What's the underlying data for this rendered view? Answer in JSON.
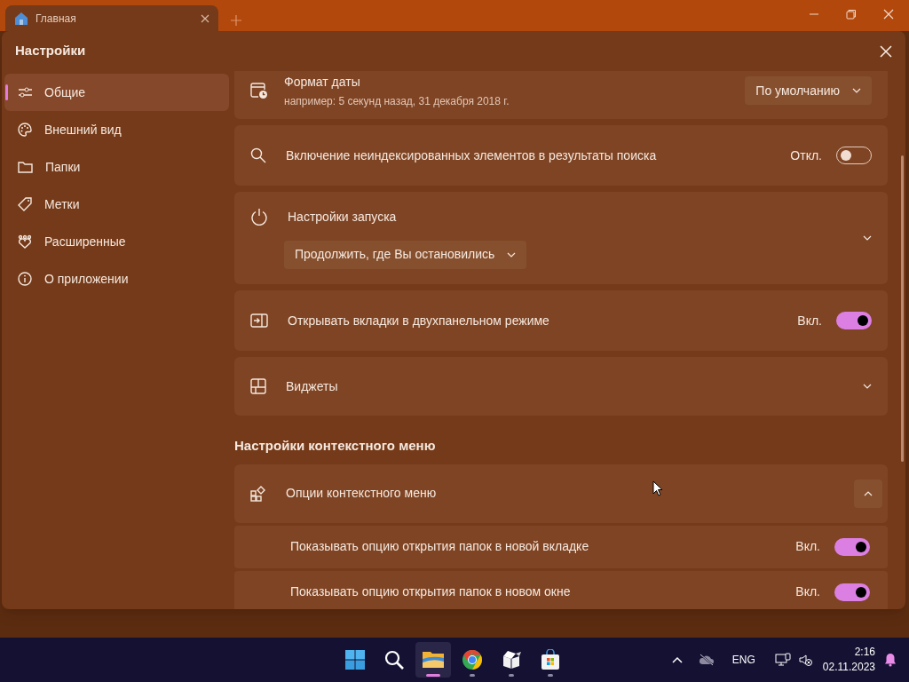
{
  "browser_tab": {
    "title": "Главная",
    "selected": true
  },
  "dialog": {
    "title": "Настройки"
  },
  "sidebar": {
    "items": [
      {
        "label": "Общие",
        "selected": true
      },
      {
        "label": "Внешний вид",
        "selected": false
      },
      {
        "label": "Папки",
        "selected": false
      },
      {
        "label": "Метки",
        "selected": false
      },
      {
        "label": "Расширенные",
        "selected": false
      },
      {
        "label": "О приложении",
        "selected": false
      }
    ]
  },
  "settings": [
    {
      "kind": "dropdown",
      "title": "Формат даты",
      "description": "например: 5 секунд назад, 31 декабря 2018 г.",
      "value": "По умолчанию"
    },
    {
      "kind": "toggle",
      "title": "Включение неиндексированных элементов в результаты поиска",
      "state_label": "Откл.",
      "on": false
    },
    {
      "kind": "expander",
      "title": "Настройки запуска",
      "expanded": false,
      "value": "Продолжить, где Вы остановились"
    },
    {
      "kind": "toggle",
      "title": "Открывать вкладки в двухпанельном режиме",
      "state_label": "Вкл.",
      "on": true
    },
    {
      "kind": "expander",
      "title": "Виджеты",
      "expanded": false
    },
    {
      "kind": "heading",
      "title": "Настройки контекстного меню"
    },
    {
      "kind": "expander",
      "title": "Опции контекстного меню",
      "expanded": true,
      "children": [
        {
          "title": "Показывать опцию открытия папок в новой вкладке",
          "state_label": "Вкл.",
          "on": true
        },
        {
          "title": "Показывать опцию открытия папок в новом окне",
          "state_label": "Вкл.",
          "on": true
        }
      ]
    }
  ],
  "taskbar": {
    "apps": [
      {
        "selected": false
      },
      {
        "selected": false
      },
      {
        "selected": true
      },
      {
        "selected": false
      },
      {
        "selected": false
      },
      {
        "selected": false
      }
    ],
    "language": "ENG",
    "time": "2:16",
    "date": "02.11.2023"
  }
}
